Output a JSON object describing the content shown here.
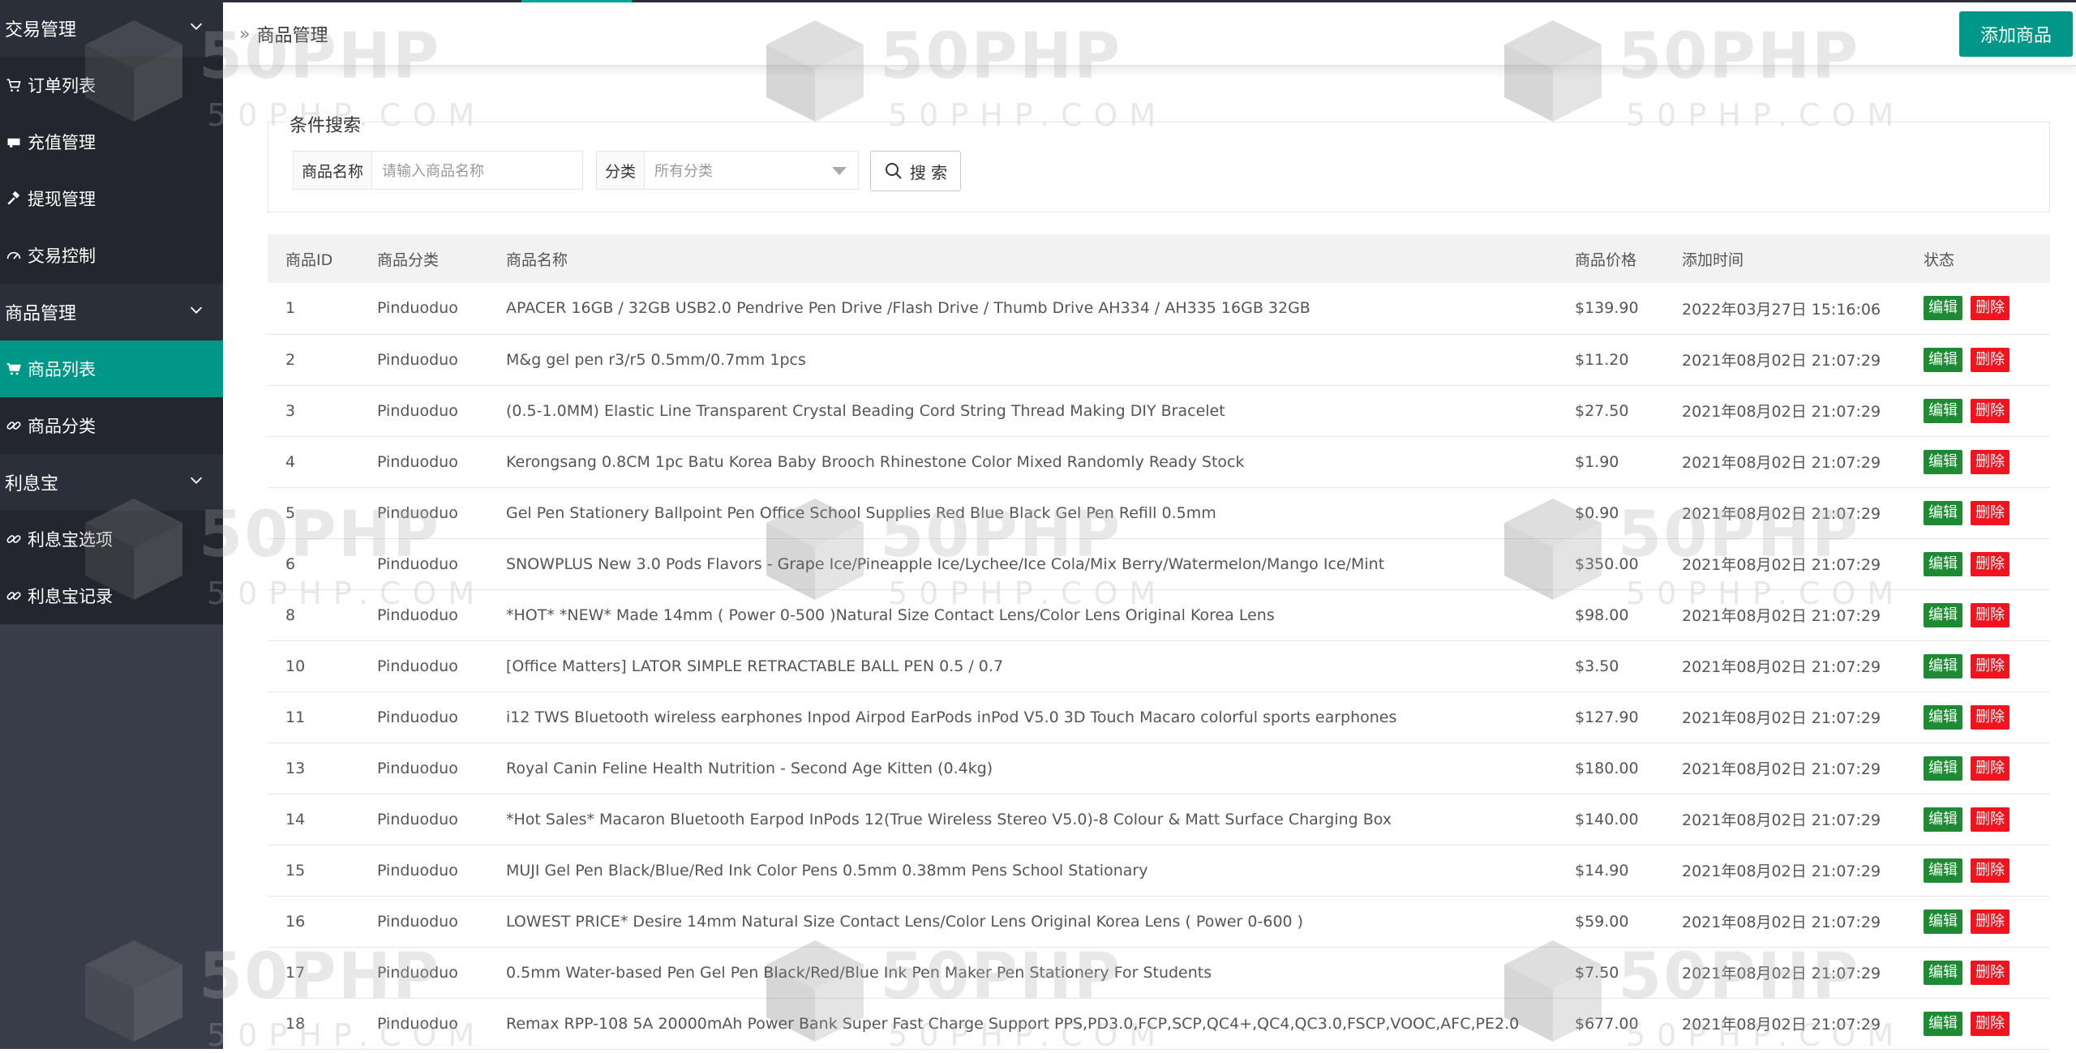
{
  "sidebar": {
    "groups": [
      {
        "label": "交易管理"
      },
      {
        "label": "商品管理"
      },
      {
        "label": "利息宝"
      }
    ],
    "items": [
      {
        "label": "订单列表",
        "icon": "cart-icon"
      },
      {
        "label": "充值管理",
        "icon": "card-icon"
      },
      {
        "label": "提现管理",
        "icon": "hammer-icon"
      },
      {
        "label": "交易控制",
        "icon": "gauge-icon"
      },
      {
        "label": "商品列表",
        "icon": "cart-icon"
      },
      {
        "label": "商品分类",
        "icon": "link-icon"
      },
      {
        "label": "利息宝选项",
        "icon": "link-icon"
      },
      {
        "label": "利息宝记录",
        "icon": "link-icon"
      }
    ]
  },
  "header": {
    "breadcrumb": "商品管理",
    "add_button": "添加商品"
  },
  "search": {
    "legend": "条件搜索",
    "name_label": "商品名称",
    "name_placeholder": "请输入商品名称",
    "category_label": "分类",
    "category_value": "所有分类",
    "search_button": "搜 索"
  },
  "table": {
    "headers": [
      "商品ID",
      "商品分类",
      "商品名称",
      "商品价格",
      "添加时间",
      "状态"
    ],
    "edit_label": "编辑",
    "delete_label": "删除",
    "rows": [
      {
        "id": "1",
        "category": "Pinduoduo",
        "name": "APACER 16GB / 32GB USB2.0 Pendrive Pen Drive /Flash Drive / Thumb Drive AH334 / AH335 16GB 32GB",
        "price": "$139.90",
        "time": "2022年03月27日 15:16:06"
      },
      {
        "id": "2",
        "category": "Pinduoduo",
        "name": "M&g gel pen r3/r5 0.5mm/0.7mm 1pcs",
        "price": "$11.20",
        "time": "2021年08月02日 21:07:29"
      },
      {
        "id": "3",
        "category": "Pinduoduo",
        "name": "(0.5-1.0MM) Elastic Line Transparent Crystal Beading Cord String Thread Making DIY Bracelet",
        "price": "$27.50",
        "time": "2021年08月02日 21:07:29"
      },
      {
        "id": "4",
        "category": "Pinduoduo",
        "name": "Kerongsang 0.8CM 1pc Batu Korea Baby Brooch Rhinestone Color Mixed Randomly Ready Stock",
        "price": "$1.90",
        "time": "2021年08月02日 21:07:29"
      },
      {
        "id": "5",
        "category": "Pinduoduo",
        "name": "Gel Pen Stationery Ballpoint Pen Office School Supplies Red Blue Black Gel Pen Refill 0.5mm",
        "price": "$0.90",
        "time": "2021年08月02日 21:07:29"
      },
      {
        "id": "6",
        "category": "Pinduoduo",
        "name": "SNOWPLUS New 3.0 Pods Flavors - Grape Ice/Pineapple Ice/Lychee/Ice Cola/Mix Berry/Watermelon/Mango Ice/Mint",
        "price": "$350.00",
        "time": "2021年08月02日 21:07:29"
      },
      {
        "id": "8",
        "category": "Pinduoduo",
        "name": "*HOT* *NEW* Made 14mm ( Power 0-500 )Natural Size Contact Lens/Color Lens Original Korea Lens",
        "price": "$98.00",
        "time": "2021年08月02日 21:07:29"
      },
      {
        "id": "10",
        "category": "Pinduoduo",
        "name": "[Office Matters] LATOR SIMPLE RETRACTABLE BALL PEN 0.5 / 0.7",
        "price": "$3.50",
        "time": "2021年08月02日 21:07:29"
      },
      {
        "id": "11",
        "category": "Pinduoduo",
        "name": "i12 TWS Bluetooth wireless earphones Inpod Airpod EarPods inPod V5.0 3D Touch Macaro colorful sports earphones",
        "price": "$127.90",
        "time": "2021年08月02日 21:07:29"
      },
      {
        "id": "13",
        "category": "Pinduoduo",
        "name": "Royal Canin Feline Health Nutrition - Second Age Kitten (0.4kg)",
        "price": "$180.00",
        "time": "2021年08月02日 21:07:29"
      },
      {
        "id": "14",
        "category": "Pinduoduo",
        "name": "*Hot Sales* Macaron Bluetooth Earpod InPods 12(True Wireless Stereo V5.0)-8 Colour & Matt Surface Charging Box",
        "price": "$140.00",
        "time": "2021年08月02日 21:07:29"
      },
      {
        "id": "15",
        "category": "Pinduoduo",
        "name": "MUJI Gel Pen Black/Blue/Red Ink Color Pens 0.5mm 0.38mm Pens School Stationary",
        "price": "$14.90",
        "time": "2021年08月02日 21:07:29"
      },
      {
        "id": "16",
        "category": "Pinduoduo",
        "name": "LOWEST PRICE* Desire 14mm Natural Size Contact Lens/Color Lens Original Korea Lens ( Power 0-600 )",
        "price": "$59.00",
        "time": "2021年08月02日 21:07:29"
      },
      {
        "id": "17",
        "category": "Pinduoduo",
        "name": "0.5mm Water-based Pen Gel Pen Black/Red/Blue Ink Pen Maker Pen Stationery For Students",
        "price": "$7.50",
        "time": "2021年08月02日 21:07:29"
      },
      {
        "id": "18",
        "category": "Pinduoduo",
        "name": "Remax RPP-108 5A 20000mAh Power Bank Super Fast Charge Support PPS,PD3.0,FCP,SCP,QC4+,QC4,QC3.0,FSCP,VOOC,AFC,PE2.0",
        "price": "$677.00",
        "time": "2021年08月02日 21:07:29"
      }
    ]
  },
  "watermark": {
    "big": "50PHP",
    "small": "50PHP.COM"
  },
  "colors": {
    "accent": "#009688",
    "edit": "#1e8a33",
    "delete": "#f0141e",
    "sidebar": "#393d49"
  }
}
